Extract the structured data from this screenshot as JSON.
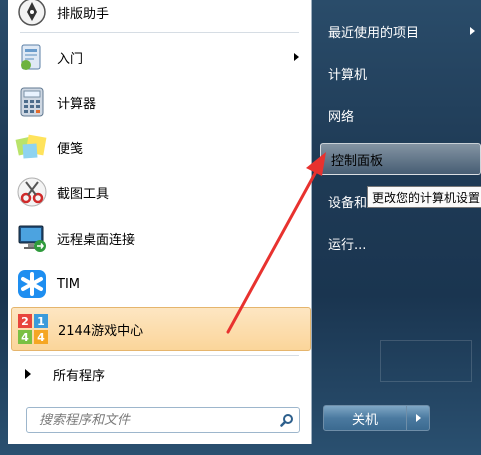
{
  "left_pane": {
    "pinned_top": {
      "label": "排版助手",
      "icon": "pen-nib-icon"
    },
    "programs": [
      {
        "label": "入门",
        "icon": "getting-started-icon",
        "has_submenu": true
      },
      {
        "label": "计算器",
        "icon": "calculator-icon",
        "has_submenu": false
      },
      {
        "label": "便笺",
        "icon": "sticky-notes-icon",
        "has_submenu": false
      },
      {
        "label": "截图工具",
        "icon": "snipping-tool-icon",
        "has_submenu": false
      },
      {
        "label": "远程桌面连接",
        "icon": "remote-desktop-icon",
        "has_submenu": false
      },
      {
        "label": "TIM",
        "icon": "tim-star-icon",
        "has_submenu": false
      },
      {
        "label": "2144游戏中心",
        "icon": "2144-game-icon",
        "has_submenu": false,
        "highlighted": true
      }
    ],
    "all_programs_label": "所有程序",
    "search_placeholder": "搜索程序和文件",
    "game_icon_digits": [
      "2",
      "1",
      "4",
      "4"
    ]
  },
  "right_pane": {
    "items": [
      {
        "label": "最近使用的项目",
        "has_submenu": true
      },
      {
        "label": "计算机",
        "has_submenu": false
      },
      {
        "label": "网络",
        "has_submenu": false
      },
      {
        "label": "控制面板",
        "has_submenu": false,
        "hover": true
      },
      {
        "label": "设备和",
        "has_submenu": false
      },
      {
        "label": "运行...",
        "has_submenu": false
      }
    ],
    "tooltip": "更改您的计算机设置",
    "shutdown_label": "关机"
  },
  "colors": {
    "highlight_bg": "#fbd59a",
    "annotation_arrow": "#e8322f",
    "start_menu_bg": "#1f3b56"
  }
}
